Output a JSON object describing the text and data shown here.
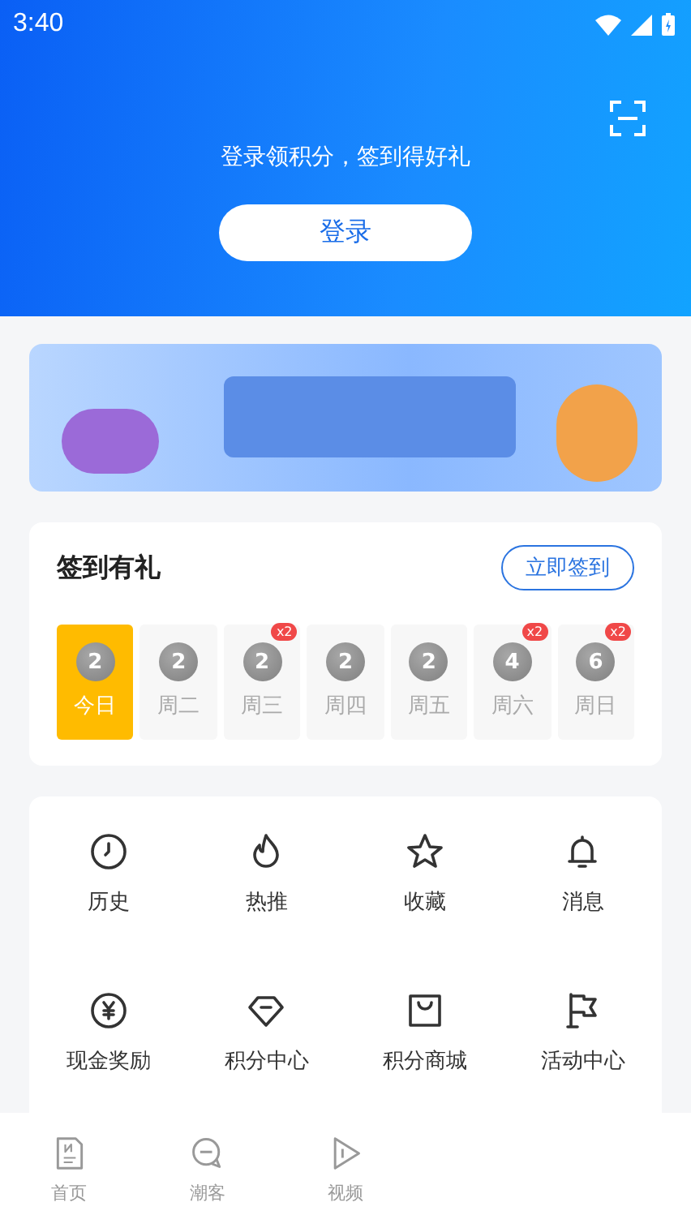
{
  "status_bar": {
    "time": "3:40"
  },
  "header": {
    "prompt": "登录领积分，签到得好礼",
    "login_button": "登录"
  },
  "checkin": {
    "title": "签到有礼",
    "button": "立即签到",
    "days": [
      {
        "points": "2",
        "label": "今日",
        "selected": true
      },
      {
        "points": "2",
        "label": "周二",
        "selected": false
      },
      {
        "points": "2",
        "label": "周三",
        "selected": false,
        "badge": "x2"
      },
      {
        "points": "2",
        "label": "周四",
        "selected": false
      },
      {
        "points": "2",
        "label": "周五",
        "selected": false
      },
      {
        "points": "4",
        "label": "周六",
        "selected": false,
        "badge": "x2"
      },
      {
        "points": "6",
        "label": "周日",
        "selected": false,
        "badge": "x2"
      }
    ]
  },
  "shortcuts": [
    {
      "label": "历史"
    },
    {
      "label": "热推"
    },
    {
      "label": "收藏"
    },
    {
      "label": "消息"
    },
    {
      "label": "现金奖励"
    },
    {
      "label": "积分中心"
    },
    {
      "label": "积分商城"
    },
    {
      "label": "活动中心"
    }
  ],
  "bottom_nav": [
    {
      "label": "首页",
      "selected": false
    },
    {
      "label": "潮客",
      "selected": false
    },
    {
      "label": "视频",
      "selected": false
    }
  ]
}
